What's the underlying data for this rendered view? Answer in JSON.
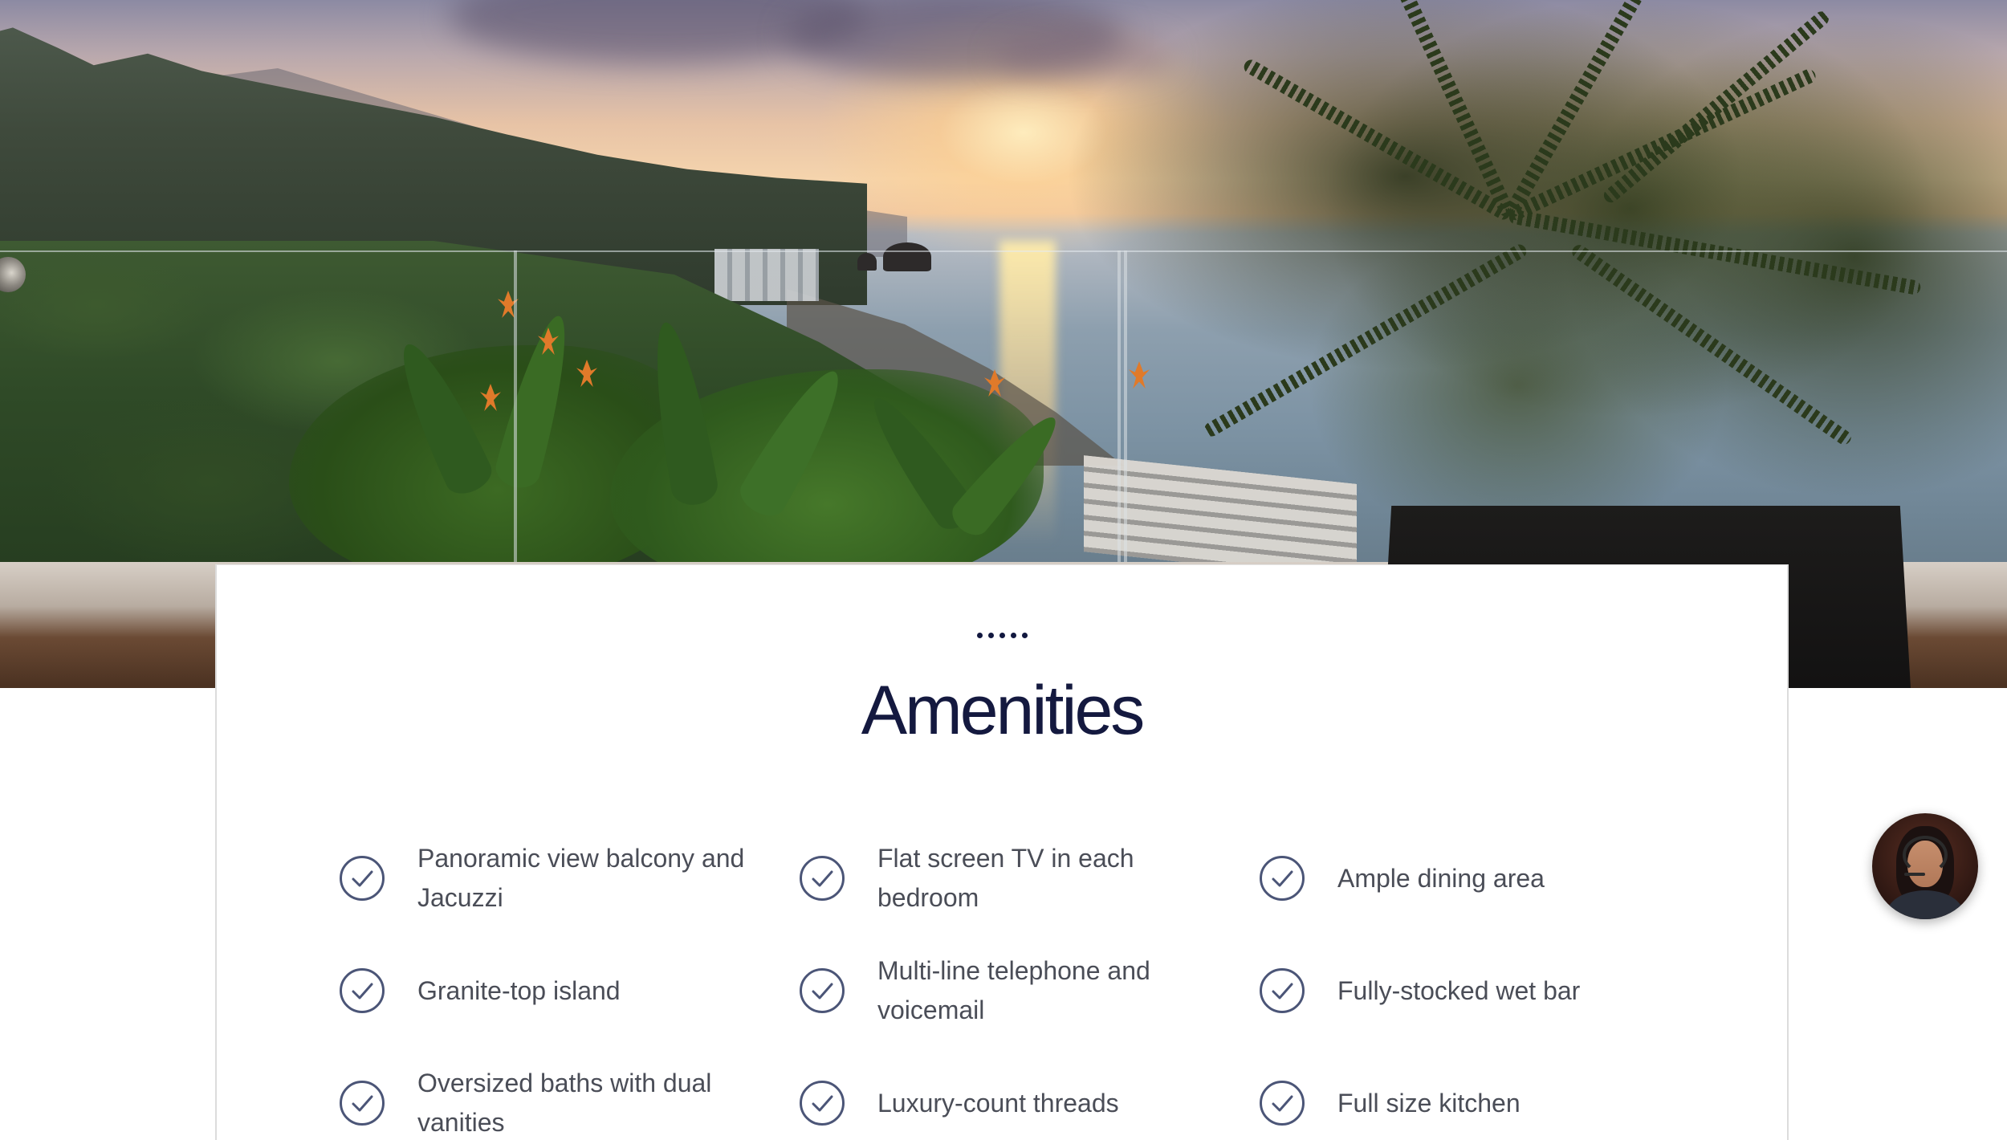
{
  "hero": {
    "image_name": "sunset-ocean-balcony-view"
  },
  "section": {
    "title": "Amenities",
    "dot_count": 5
  },
  "amenities": [
    {
      "label": "Panoramic view balcony and Jacuzzi",
      "icon": "check-circle-icon"
    },
    {
      "label": "Flat screen TV in each bedroom",
      "icon": "check-circle-icon"
    },
    {
      "label": "Ample dining area",
      "icon": "check-circle-icon"
    },
    {
      "label": "Granite-top island",
      "icon": "check-circle-icon"
    },
    {
      "label": "Multi-line telephone and voicemail",
      "icon": "check-circle-icon"
    },
    {
      "label": "Fully-stocked wet bar",
      "icon": "check-circle-icon"
    },
    {
      "label": "Oversized baths with dual vanities",
      "icon": "check-circle-icon"
    },
    {
      "label": "Luxury-count threads",
      "icon": "check-circle-icon"
    },
    {
      "label": "Full size kitchen",
      "icon": "check-circle-icon"
    }
  ],
  "chat": {
    "icon": "support-agent-avatar"
  },
  "colors": {
    "title": "#14193f",
    "text": "#4a4d57",
    "icon_stroke": "#4b5577",
    "card_border": "#dcdcdc"
  }
}
